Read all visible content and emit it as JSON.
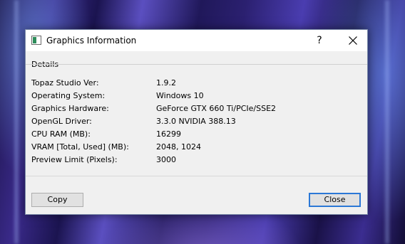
{
  "window": {
    "title": "Graphics Information",
    "help_label": "?"
  },
  "details": {
    "group_label": "Details",
    "rows": [
      {
        "key": "Topaz Studio Ver:",
        "value": "1.9.2"
      },
      {
        "key": "Operating System:",
        "value": "Windows 10"
      },
      {
        "key": "Graphics Hardware:",
        "value": "GeForce GTX 660 Ti/PCIe/SSE2"
      },
      {
        "key": "OpenGL Driver:",
        "value": "3.3.0 NVIDIA 388.13"
      },
      {
        "key": "CPU RAM (MB):",
        "value": "16299"
      },
      {
        "key": "VRAM [Total, Used] (MB):",
        "value": "2048, 1024"
      },
      {
        "key": "Preview Limit (Pixels):",
        "value": "3000"
      }
    ]
  },
  "buttons": {
    "copy_label": "Copy",
    "close_label": "Close"
  },
  "colors": {
    "accent": "#2b78d6",
    "dialog_bg": "#f0f0f0"
  }
}
